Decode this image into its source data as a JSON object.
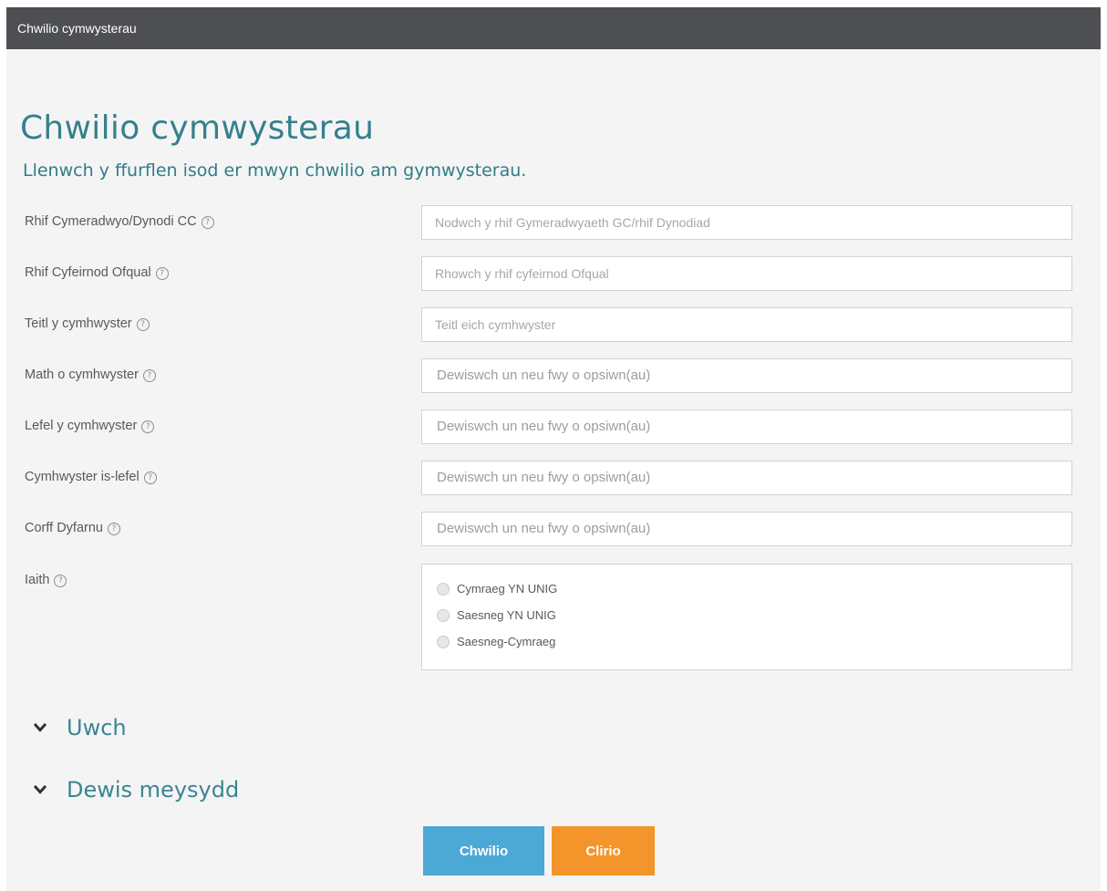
{
  "header": {
    "title": "Chwilio cymwysterau"
  },
  "page": {
    "title": "Chwilio cymwysterau",
    "subtitle": "Llenwch y ffurflen isod er mwyn chwilio am gymwysterau."
  },
  "form": {
    "approval_number": {
      "label": "Rhif Cymeradwyo/Dynodi CC",
      "placeholder": "Nodwch y rhif Gymeradwyaeth GC/rhif Dynodiad"
    },
    "ofqual_number": {
      "label": "Rhif Cyfeirnod Ofqual",
      "placeholder": "Rhowch y rhif cyfeirnod Ofqual"
    },
    "title": {
      "label": "Teitl y cymhwyster",
      "placeholder": "Teitl eich cymhwyster"
    },
    "type": {
      "label": "Math o cymhwyster",
      "placeholder": "Dewiswch un neu fwy o opsiwn(au)"
    },
    "level": {
      "label": "Lefel y cymhwyster",
      "placeholder": "Dewiswch un neu fwy o opsiwn(au)"
    },
    "sublevel": {
      "label": "Cymhwyster is-lefel",
      "placeholder": "Dewiswch un neu fwy o opsiwn(au)"
    },
    "awarding_body": {
      "label": "Corff Dyfarnu",
      "placeholder": "Dewiswch un neu fwy o opsiwn(au)"
    },
    "language": {
      "label": "Iaith",
      "options": [
        "Cymraeg YN UNIG",
        "Saesneg YN UNIG",
        "Saesneg-Cymraeg"
      ]
    },
    "help_glyph": "?"
  },
  "sections": {
    "advanced": "Uwch",
    "choose_fields": "Dewis meysydd"
  },
  "buttons": {
    "search": "Chwilio",
    "clear": "Clirio"
  },
  "colors": {
    "topbar": "#4d4f52",
    "heading": "#35808c",
    "search_button": "#4ca8d4",
    "clear_button": "#f3952a"
  },
  "icons": {
    "help": "help-circle-icon",
    "toggle": "chevron-down-icon"
  }
}
